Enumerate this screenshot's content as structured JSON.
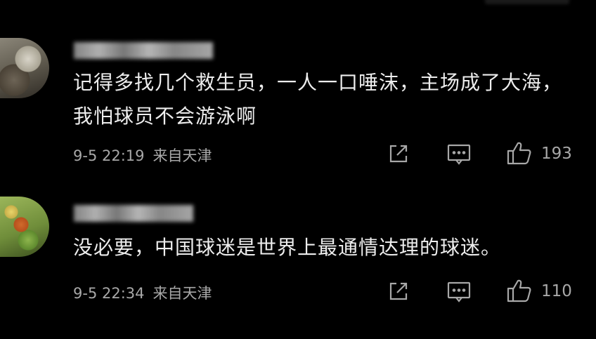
{
  "comments": [
    {
      "avatar_icon": "user-avatar",
      "username": "",
      "text": "记得多找几个救生员，一人一口唾沫，主场成了大海，我怕球员不会游泳啊",
      "time": "9-5 22:19",
      "location": "来自天津",
      "likes": "193",
      "actions": [
        "share-icon",
        "comment-icon",
        "thumbs-up-icon"
      ]
    },
    {
      "avatar_icon": "user-avatar",
      "username": "",
      "text": "没必要，中国球迷是世界上最通情达理的球迷。",
      "time": "9-5 22:34",
      "location": "来自天津",
      "likes": "110",
      "actions": [
        "share-icon",
        "comment-icon",
        "thumbs-up-icon"
      ]
    }
  ],
  "colors": {
    "background": "#000000",
    "text": "#ededed",
    "meta": "#a8a8a8"
  }
}
